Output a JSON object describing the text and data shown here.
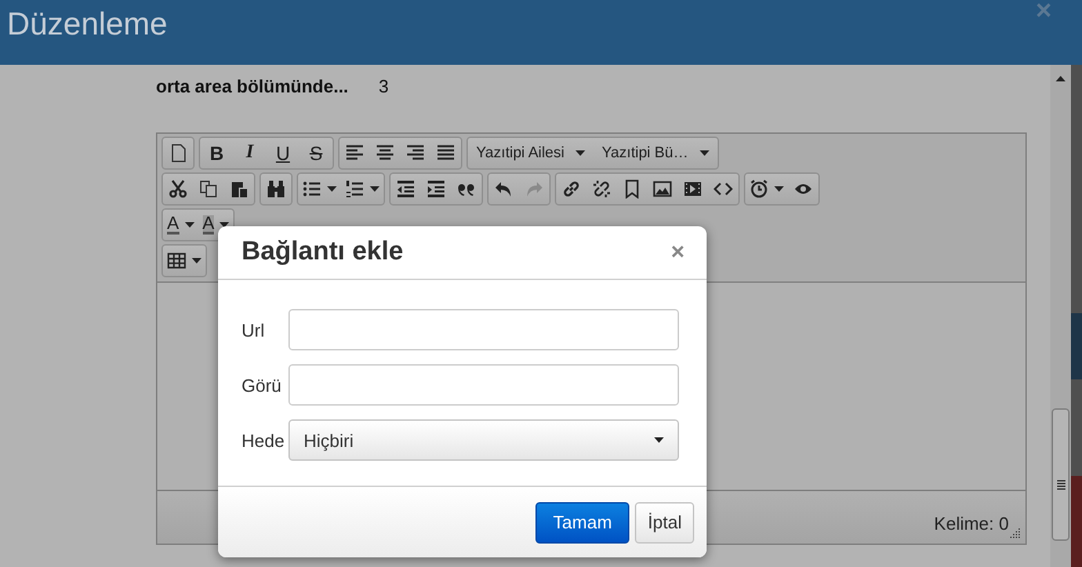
{
  "window": {
    "title": "Düzenleme",
    "close": "×"
  },
  "field": {
    "label": "orta area bölümünde...",
    "value": "3"
  },
  "toolbar": {
    "format_buttons": [
      {
        "label": "B",
        "kind": "bold"
      },
      {
        "label": "I",
        "kind": "italic"
      },
      {
        "label": "U",
        "kind": "underline"
      },
      {
        "label": "S",
        "kind": "strike"
      }
    ],
    "font_dropdowns": [
      {
        "label": "Yazıtipi Ailesi"
      },
      {
        "label": "Yazıtipi Bü…"
      }
    ],
    "color_buttons": [
      {
        "label": "A",
        "kind": "text"
      },
      {
        "label": "A",
        "kind": "background"
      }
    ]
  },
  "status_bar": {
    "word_count": "Kelime: 0"
  },
  "dialog": {
    "title": "Bağlantı ekle",
    "close": "×",
    "fields": [
      {
        "kind": "text",
        "label": "Url"
      },
      {
        "kind": "text",
        "label": "Görü"
      },
      {
        "kind": "select",
        "label": "Hede",
        "value": "Hiçbiri"
      }
    ],
    "buttons": [
      {
        "label": "Tamam",
        "primary": true
      },
      {
        "label": "İptal",
        "primary": false
      }
    ]
  }
}
